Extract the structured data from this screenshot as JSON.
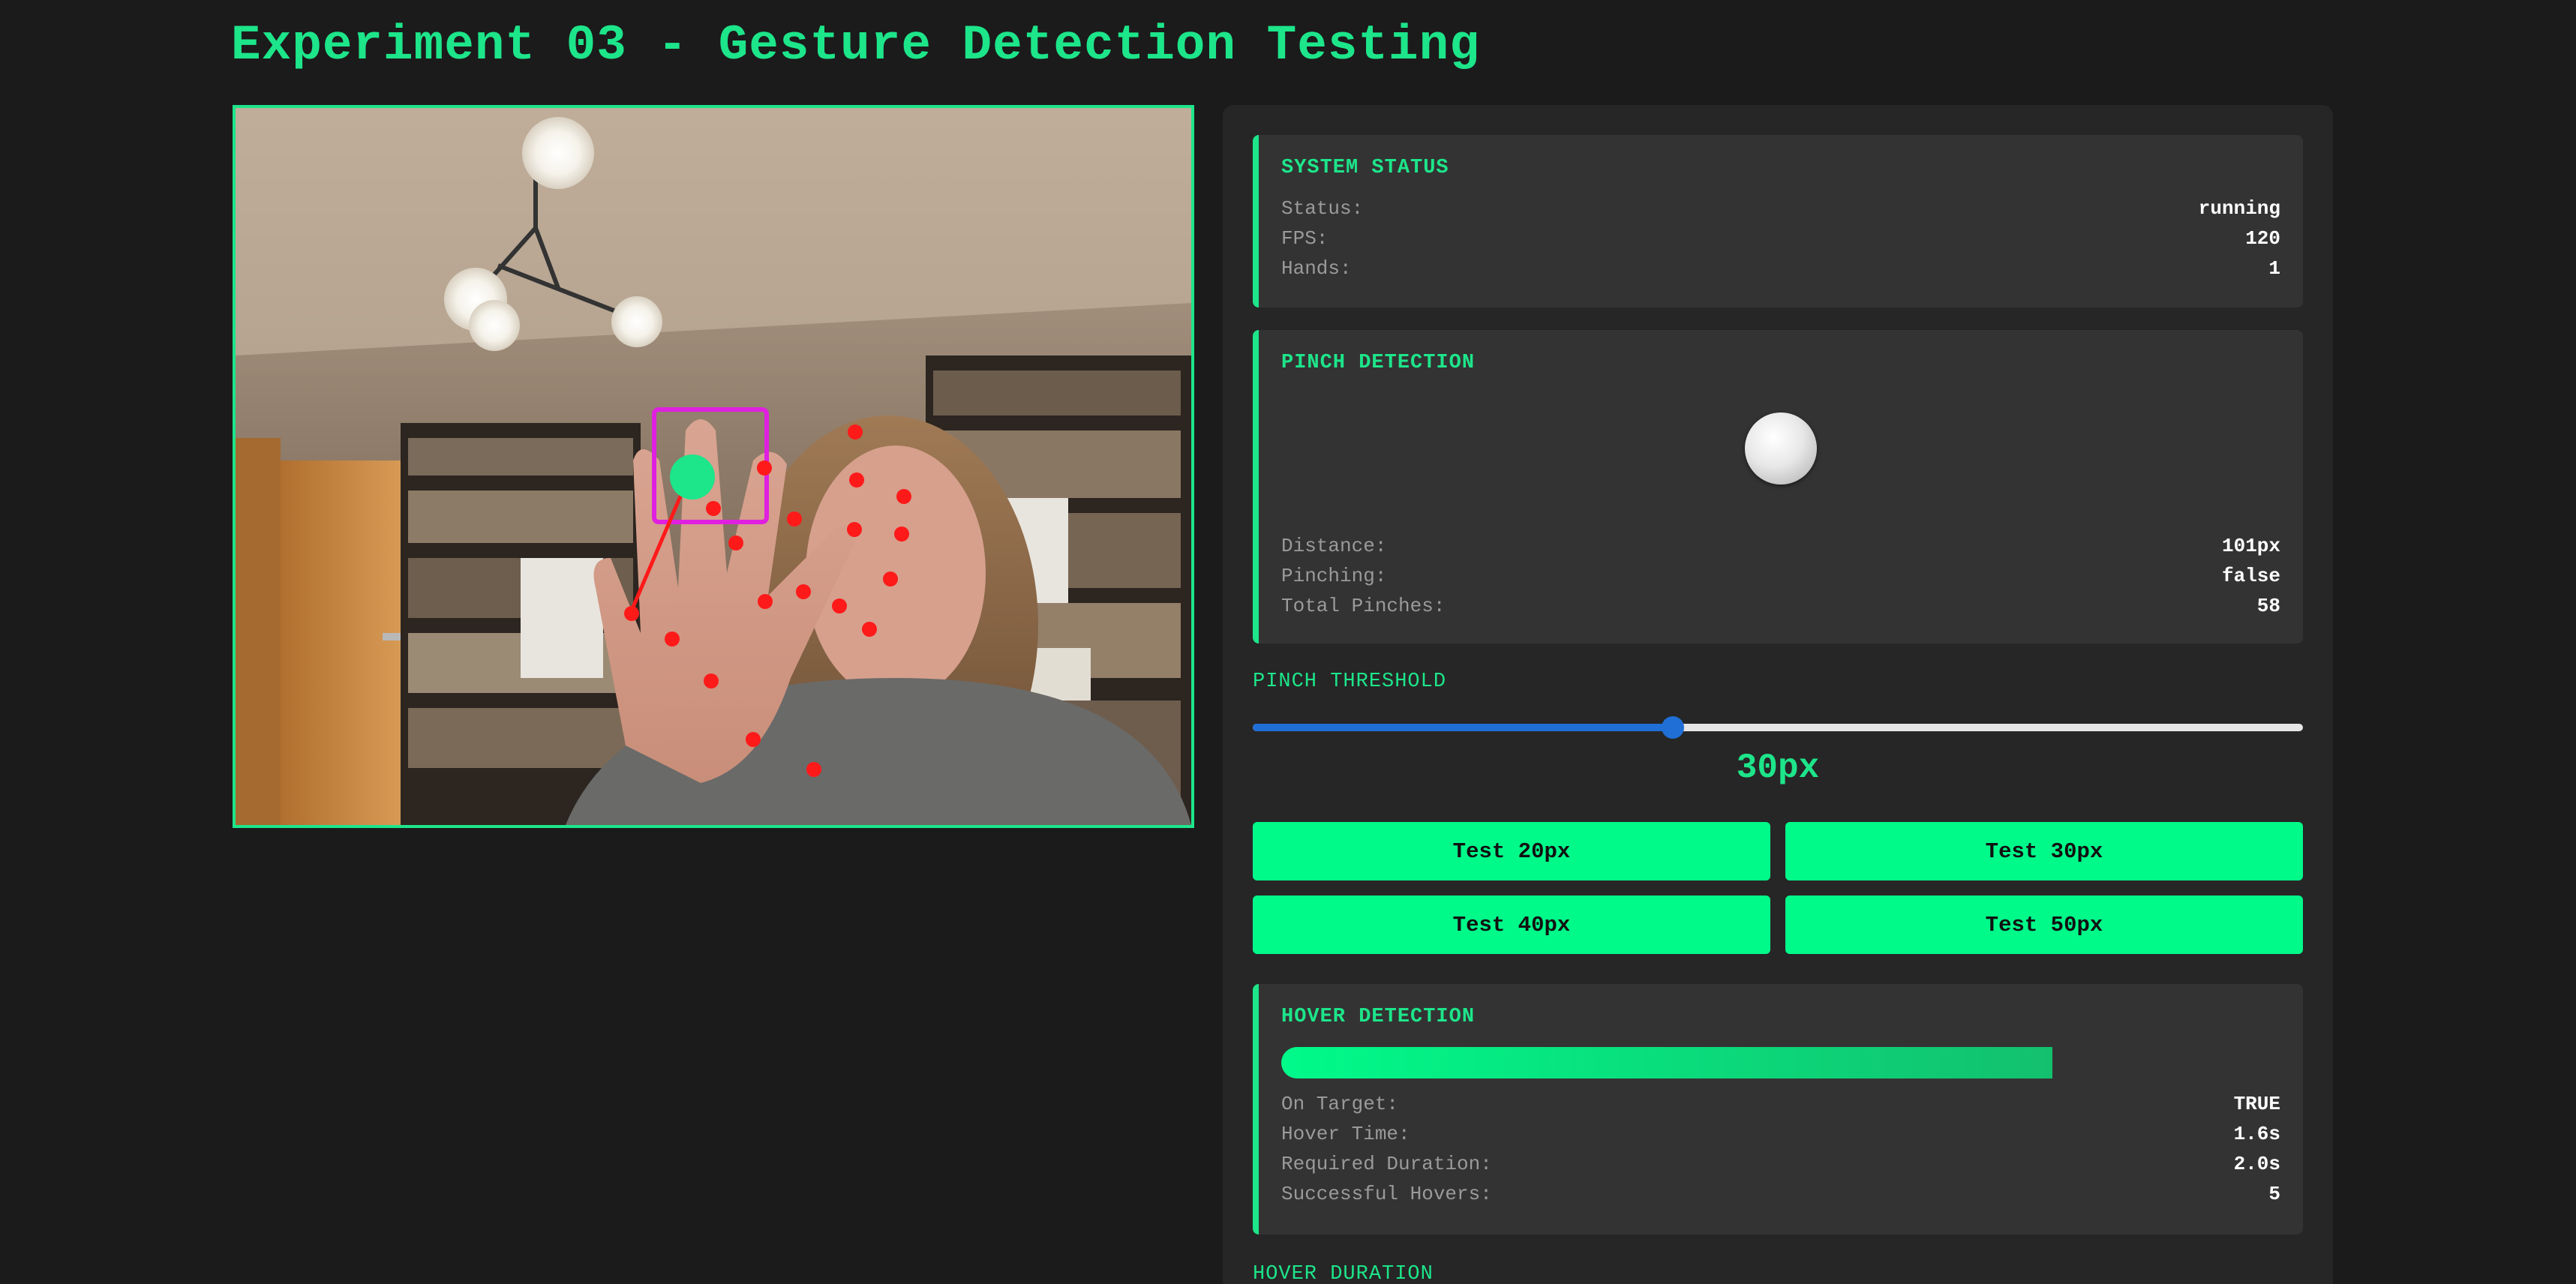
{
  "header": {
    "title": "Experiment 03 - Gesture Detection Testing"
  },
  "system_status": {
    "title": "SYSTEM STATUS",
    "rows": [
      {
        "label": "Status:",
        "value": "running"
      },
      {
        "label": "FPS:",
        "value": "120"
      },
      {
        "label": "Hands:",
        "value": "1"
      }
    ]
  },
  "pinch_detection": {
    "title": "PINCH DETECTION",
    "rows": [
      {
        "label": "Distance:",
        "value": "101px"
      },
      {
        "label": "Pinching:",
        "value": "false"
      },
      {
        "label": "Total Pinches:",
        "value": "58"
      }
    ]
  },
  "pinch_threshold": {
    "label": "PINCH THRESHOLD",
    "value_text": "30px",
    "slider_fraction": 0.4
  },
  "test_buttons": [
    {
      "label": "Test 20px"
    },
    {
      "label": "Test 30px"
    },
    {
      "label": "Test 40px"
    },
    {
      "label": "Test 50px"
    }
  ],
  "hover_detection": {
    "title": "HOVER DETECTION",
    "progress_fraction": 0.8,
    "rows": [
      {
        "label": "On Target:",
        "value": "TRUE"
      },
      {
        "label": "Hover Time:",
        "value": "1.6s"
      },
      {
        "label": "Required Duration:",
        "value": "2.0s"
      },
      {
        "label": "Successful Hovers:",
        "value": "5"
      }
    ]
  },
  "hover_duration": {
    "label": "HOVER DURATION"
  },
  "colors": {
    "accent": "#1de58a",
    "button": "#00fa8a",
    "slider": "#1f6fd6",
    "landmark": "#ff1a1a",
    "target_box": "#e020e0",
    "cursor": "#1de58a"
  }
}
